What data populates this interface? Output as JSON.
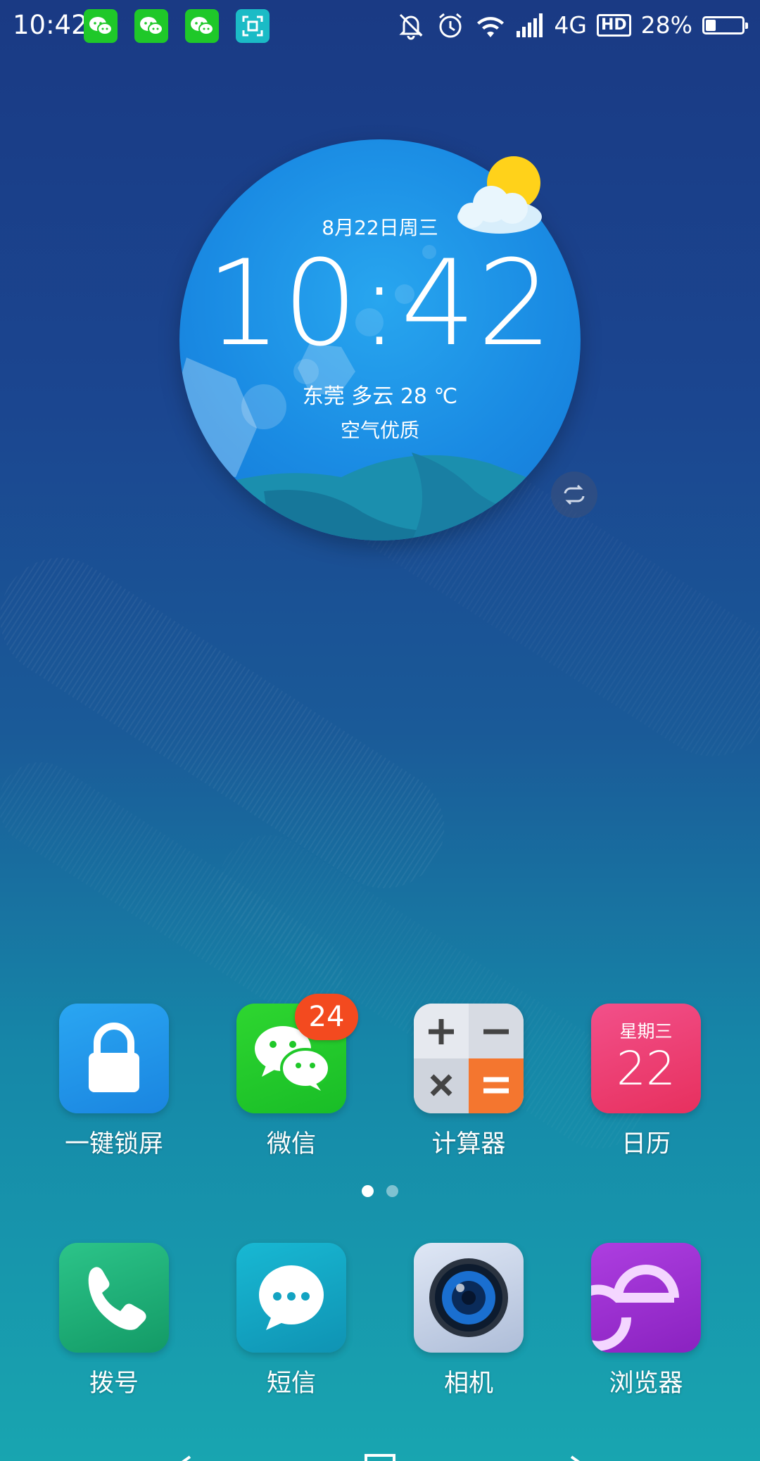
{
  "status_bar": {
    "time": "10:42",
    "network": "4G",
    "hd": "HD",
    "battery_percent": "28%",
    "battery_level": 0.28,
    "notification_icons": [
      "wechat-icon",
      "wechat-icon",
      "wechat-icon",
      "screenshot-icon"
    ],
    "system_icons": [
      "mute-bell-icon",
      "alarm-icon",
      "wifi-icon",
      "signal-icon"
    ]
  },
  "clock_widget": {
    "date": "8月22日周三",
    "time": "10:42",
    "weather": "东莞 多云 28 ℃",
    "air_quality": "空气优质",
    "weather_icon": "partly-cloudy-icon",
    "refresh_icon": "refresh-icon"
  },
  "apps": [
    {
      "label": "一键锁屏",
      "icon": "lock-icon"
    },
    {
      "label": "微信",
      "icon": "wechat-icon",
      "badge": "24"
    },
    {
      "label": "计算器",
      "icon": "calculator-icon"
    },
    {
      "label": "日历",
      "icon": "calendar-icon",
      "weekday": "星期三",
      "day": "22"
    }
  ],
  "dock": [
    {
      "label": "拨号",
      "icon": "phone-icon"
    },
    {
      "label": "短信",
      "icon": "message-icon"
    },
    {
      "label": "相机",
      "icon": "camera-icon"
    },
    {
      "label": "浏览器",
      "icon": "browser-icon"
    }
  ],
  "pagination": {
    "current": 1,
    "total": 2
  },
  "colors": {
    "wechat_green": "#1fc829",
    "lock_blue": "#1a8de6",
    "calendar_pink": "#ee3a6c",
    "calculator_orange": "#f4762f",
    "phone_green": "#1fae73",
    "sms_teal": "#13a3c2",
    "browser_purple": "#9b2fd0",
    "badge_red": "#f34a1f"
  }
}
